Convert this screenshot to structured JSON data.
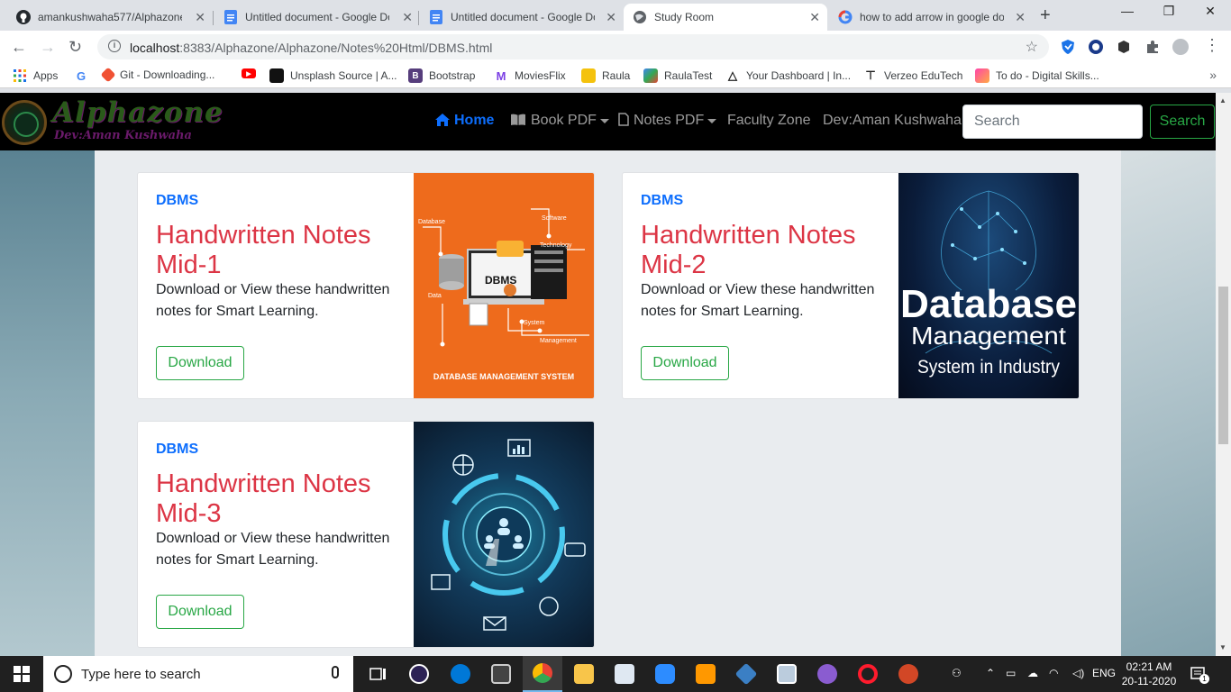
{
  "browser": {
    "tabs": [
      {
        "label": "amankushwaha577/Alphazone",
        "icon": "github-icon",
        "active": false
      },
      {
        "label": "Untitled document - Google Docs",
        "icon": "google-docs-icon",
        "active": false
      },
      {
        "label": "Untitled document - Google Docs",
        "icon": "google-docs-icon",
        "active": false
      },
      {
        "label": "Study Room",
        "icon": "globe-icon",
        "active": true
      },
      {
        "label": "how to add arrow in google docs",
        "icon": "google-icon",
        "active": false
      }
    ],
    "url_host": "localhost",
    "url_rest": ":8383/Alphazone/Alphazone/Notes%20Html/DBMS.html",
    "bookmarks": [
      {
        "label": "Apps",
        "icon": "apps-grid-icon"
      },
      {
        "label": "",
        "icon": "google-icon"
      },
      {
        "label": "Git - Downloading...",
        "icon": "git-icon"
      },
      {
        "label": "",
        "icon": "youtube-icon"
      },
      {
        "label": "Unsplash Source | A...",
        "icon": "unsplash-icon"
      },
      {
        "label": "Bootstrap",
        "icon": "bootstrap-icon"
      },
      {
        "label": "MoviesFlix",
        "icon": "moviesflix-icon"
      },
      {
        "label": "Raula",
        "icon": "raula-icon"
      },
      {
        "label": "RaulaTest",
        "icon": "raulatest-icon"
      },
      {
        "label": "Your Dashboard | In...",
        "icon": "dashboard-icon"
      },
      {
        "label": "Verzeo EduTech",
        "icon": "verzeo-icon"
      },
      {
        "label": "To do - Digital Skills...",
        "icon": "todo-icon"
      }
    ]
  },
  "site": {
    "brand_name": "Alphazone",
    "brand_dev": "Dev:Aman Kushwaha",
    "nav": {
      "home": "Home",
      "book_pdf": "Book PDF",
      "notes_pdf": "Notes PDF",
      "faculty_zone": "Faculty Zone",
      "dev": "Dev:Aman Kushwaha"
    },
    "search_placeholder": "Search",
    "search_button": "Search",
    "cards": [
      {
        "category": "DBMS",
        "title": "Handwritten Notes Mid-1",
        "text": "Download or View these handwritten notes for Smart Learning.",
        "button": "Download",
        "image_labels": {
          "center": "DBMS",
          "database": "Database",
          "software": "Software",
          "technology": "Technology",
          "data": "Data",
          "system": "System",
          "management": "Management",
          "caption": "DATABASE MANAGEMENT SYSTEM"
        }
      },
      {
        "category": "DBMS",
        "title": "Handwritten Notes Mid-2",
        "text": "Download or View these handwritten notes for Smart Learning.",
        "button": "Download",
        "image_labels": {
          "line1": "Database",
          "line2": "Management",
          "line3": "System in Industry"
        }
      },
      {
        "category": "DBMS",
        "title": "Handwritten Notes Mid-3",
        "text": "Download or View these handwritten notes for Smart Learning.",
        "button": "Download"
      }
    ]
  },
  "taskbar": {
    "search_placeholder": "Type here to search",
    "language": "ENG",
    "time": "02:21 AM",
    "date": "20-11-2020",
    "notification_count": "1"
  },
  "colors": {
    "accent_blue": "#0d6efd",
    "title_red": "#dc3545",
    "button_green": "#28a745",
    "navbar_black": "#000000"
  }
}
